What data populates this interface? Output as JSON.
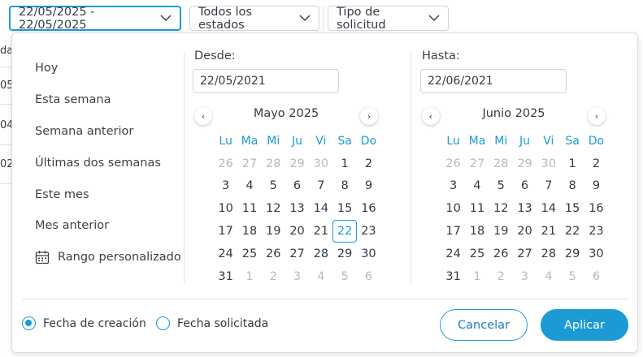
{
  "toolbar": {
    "date_range": "22/05/2025 - 22/05/2025",
    "status_filter": "Todos los estados",
    "type_filter": "Tipo de solicitud"
  },
  "background": {
    "header_fragment": "da",
    "row_fragments": [
      "05",
      "04",
      "02"
    ]
  },
  "presets": [
    "Hoy",
    "Esta semana",
    "Semana anterior",
    "Últimas dos semanas",
    "Este mes",
    "Mes anterior",
    "Rango personalizado"
  ],
  "from": {
    "label": "Desde:",
    "value": "22/05/2021",
    "month": "Mayo 2025",
    "weekdays": [
      "Lu",
      "Ma",
      "Mi",
      "Ju",
      "Vi",
      "Sa",
      "Do"
    ],
    "days": [
      [
        "26",
        "27",
        "28",
        "29",
        "30",
        "1",
        "2"
      ],
      [
        "3",
        "4",
        "5",
        "6",
        "7",
        "8",
        "9"
      ],
      [
        "10",
        "11",
        "12",
        "13",
        "14",
        "15",
        "16"
      ],
      [
        "17",
        "18",
        "19",
        "20",
        "21",
        "22",
        "23"
      ],
      [
        "24",
        "25",
        "26",
        "27",
        "28",
        "29",
        "30"
      ],
      [
        "31",
        "1",
        "2",
        "3",
        "4",
        "5",
        "6"
      ]
    ],
    "muted": [
      [
        0,
        0
      ],
      [
        0,
        1
      ],
      [
        0,
        2
      ],
      [
        0,
        3
      ],
      [
        0,
        4
      ],
      [
        5,
        1
      ],
      [
        5,
        2
      ],
      [
        5,
        3
      ],
      [
        5,
        4
      ],
      [
        5,
        5
      ],
      [
        5,
        6
      ]
    ],
    "selected": [
      [
        3,
        5
      ]
    ]
  },
  "to": {
    "label": "Hasta:",
    "value": "22/06/2021",
    "month": "Junio 2025",
    "weekdays": [
      "Lu",
      "Ma",
      "Mi",
      "Ju",
      "Vi",
      "Sa",
      "Do"
    ],
    "days": [
      [
        "26",
        "27",
        "28",
        "29",
        "30",
        "1",
        "2"
      ],
      [
        "3",
        "4",
        "5",
        "6",
        "7",
        "8",
        "9"
      ],
      [
        "10",
        "11",
        "12",
        "13",
        "14",
        "15",
        "16"
      ],
      [
        "17",
        "18",
        "19",
        "20",
        "21",
        "22",
        "23"
      ],
      [
        "24",
        "25",
        "26",
        "27",
        "28",
        "29",
        "30"
      ],
      [
        "31",
        "1",
        "2",
        "3",
        "4",
        "5",
        "6"
      ]
    ],
    "muted": [
      [
        0,
        0
      ],
      [
        0,
        1
      ],
      [
        0,
        2
      ],
      [
        0,
        3
      ],
      [
        0,
        4
      ],
      [
        5,
        1
      ],
      [
        5,
        2
      ],
      [
        5,
        3
      ],
      [
        5,
        4
      ],
      [
        5,
        5
      ],
      [
        5,
        6
      ]
    ],
    "selected": []
  },
  "date_field": {
    "options": [
      "Fecha de creación",
      "Fecha solicitada"
    ],
    "selected": "Fecha de creación"
  },
  "actions": {
    "cancel": "Cancelar",
    "apply": "Aplicar"
  },
  "colors": {
    "accent": "#1c9ad6",
    "muted_day": "#b4bac1"
  }
}
